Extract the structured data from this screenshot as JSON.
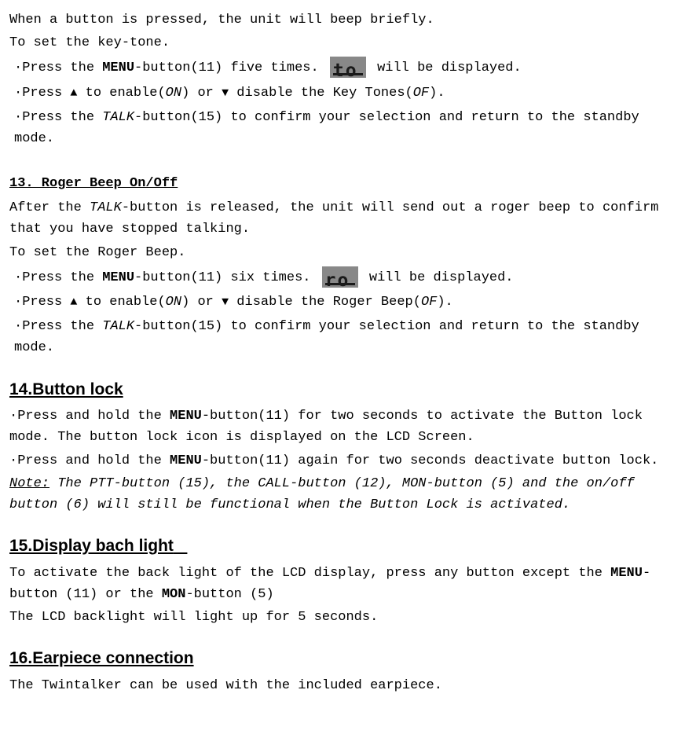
{
  "s12": {
    "line1": "When a button is pressed, the unit will beep briefly.",
    "line2": "To set the key-tone.",
    "b1a": "·Press the ",
    "b1b": "MENU",
    "b1c": "-button(11) five times. ",
    "lcd1": "to",
    "b1d": " will be displayed.",
    "b2a": "·Press ",
    "b2b": " to enable(",
    "b2c": "ON",
    "b2d": ") or ",
    "b2e": " disable the Key Tones(",
    "b2f": "OF",
    "b2g": ").",
    "b3a": "·Press the ",
    "b3b": "TALK",
    "b3c": "-button(15) to confirm your selection and return to the standby mode."
  },
  "s13": {
    "heading": "13. Roger Beep On/Off",
    "p1a": "After the ",
    "p1b": "TALK",
    "p1c": "-button is released, the unit will send out a roger beep to confirm that you have stopped talking.",
    "p2": "To set the Roger Beep.",
    "b1a": "·Press the ",
    "b1b": "MENU",
    "b1c": "-button(11) six times. ",
    "lcd2": "ro",
    "b1d": " will be displayed.",
    "b2a": "·Press ",
    "b2b": " to enable(",
    "b2c": "ON",
    "b2d": ") or ",
    "b2e": " disable the Roger Beep(",
    "b2f": "OF",
    "b2g": ").",
    "b3a": "·Press the ",
    "b3b": "TALK",
    "b3c": "-button(15) to confirm your selection and return to the standby mode."
  },
  "s14": {
    "heading": "14.Button lock",
    "b1a": "·Press and hold the ",
    "b1b": "MENU",
    "b1c": "-button(11) for two seconds to activate the Button lock mode. The button lock icon is displayed on the LCD Screen.",
    "b2a": "·Press and hold the ",
    "b2b": "MENU",
    "b2c": "-button(11) again for two seconds deactivate button lock.",
    "note_label": "Note:",
    "note_body": " The PTT-button (15), the CALL-button (12), MON-button (5) and the on/off button (6) will still be functional when the Button Lock is activated."
  },
  "s15": {
    "heading": "15.Display bach light",
    "p1a": "To activate the back light of the LCD display, press any button except the ",
    "p1b": "MENU",
    "p1c": "-button (11) or the ",
    "p1d": "MON",
    "p1e": "-button (5)",
    "p2": "The LCD backlight will light up for 5 seconds."
  },
  "s16": {
    "heading": "16.Earpiece connection",
    "p1": "The Twintalker can be used with the included earpiece."
  },
  "arrows": {
    "up": "▲",
    "down": "▼"
  }
}
